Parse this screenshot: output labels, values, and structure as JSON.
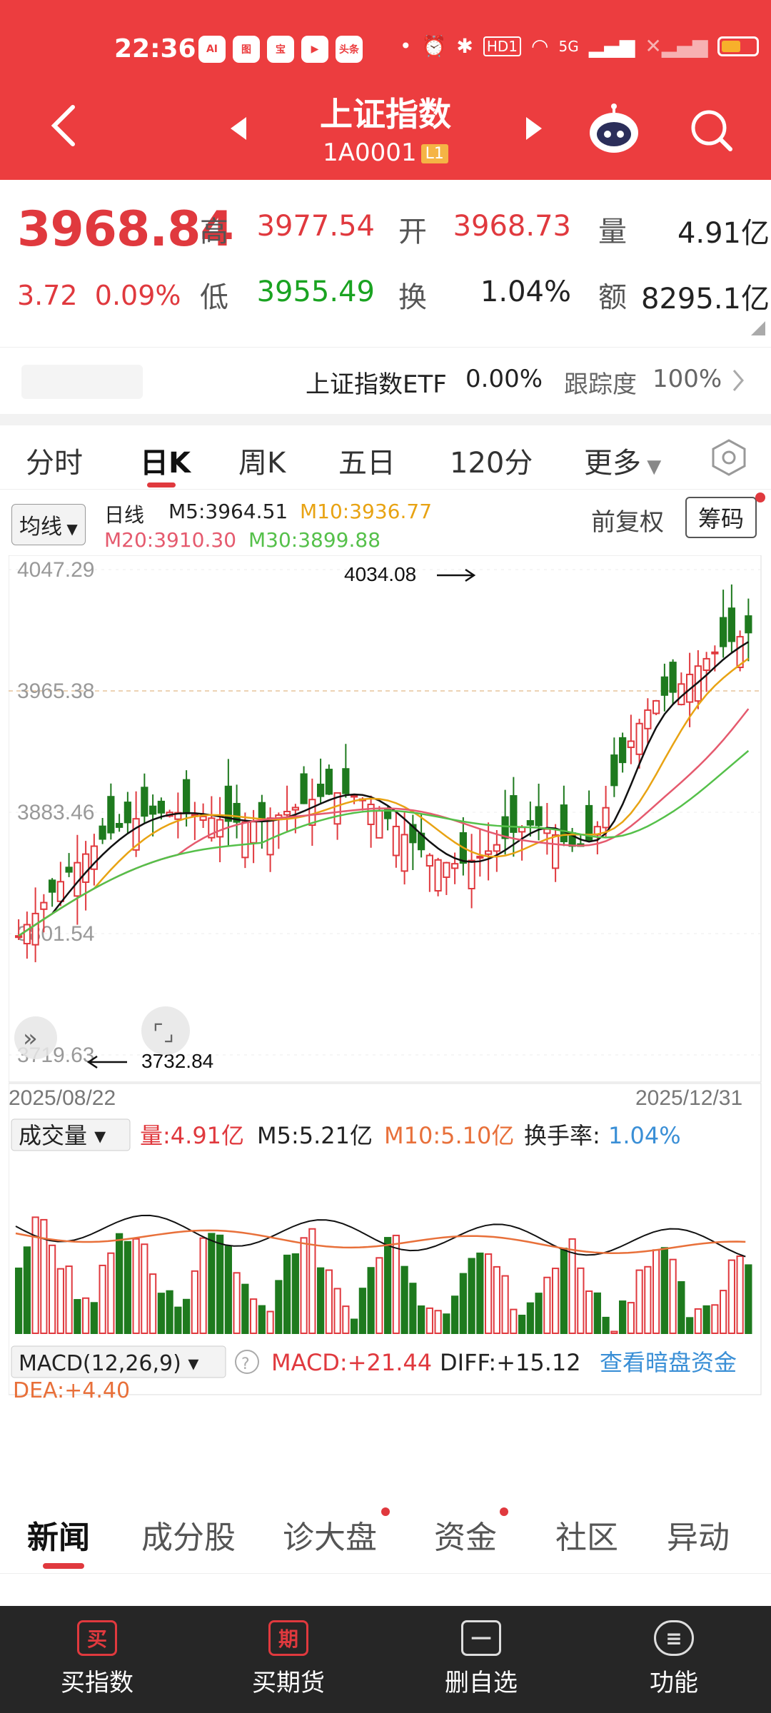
{
  "status_bar": {
    "time": "22:36",
    "apps": [
      "AI",
      "图",
      "宝",
      "▶",
      "头条"
    ],
    "network": "5G",
    "hd": "HD1"
  },
  "header": {
    "title": "上证指数",
    "code": "1A0001",
    "level_badge": "L1",
    "accent": "#ec3d3f"
  },
  "quote": {
    "price": "3968.84",
    "change": "3.72",
    "change_pct": "0.09%",
    "high_label": "高",
    "high": "3977.54",
    "low_label": "低",
    "low": "3955.49",
    "open_label": "开",
    "open": "3968.73",
    "turnover_label": "换",
    "turnover": "1.04%",
    "volume_label": "量",
    "volume": "4.91亿",
    "amount_label": "额",
    "amount": "8295.1亿"
  },
  "etf": {
    "name": "上证指数ETF",
    "pct": "0.00%",
    "tracking_label": "跟踪度",
    "tracking": "100%"
  },
  "tabs": [
    "分时",
    "日K",
    "周K",
    "五日",
    "120分",
    "更多"
  ],
  "active_tab": 1,
  "kline": {
    "ma_button": "均线",
    "period_label": "日线",
    "ma5": "M5:3964.51",
    "ma10": "M10:3936.77",
    "ma20": "M20:3910.30",
    "ma30": "M30:3899.88",
    "adjust": "前复权",
    "chips": "筹码",
    "y_labels": [
      "4047.29",
      "3965.38",
      "3883.46",
      "3801.54",
      "3719.63"
    ],
    "max_marker": "4034.08",
    "min_marker": "3732.84",
    "date_start": "2025/08/22",
    "date_end": "2025/12/31"
  },
  "volume": {
    "button": "成交量",
    "vol": "量:4.91亿",
    "m5": "M5:5.21亿",
    "m10": "M10:5.10亿",
    "turnover_label": "换手率:",
    "turnover": "1.04%"
  },
  "macd": {
    "button": "MACD(12,26,9)",
    "macd": "MACD:+21.44",
    "diff": "DIFF:+15.12",
    "dea": "DEA:+4.40",
    "link": "查看暗盘资金"
  },
  "bottom_tabs": [
    "新闻",
    "成分股",
    "诊大盘",
    "资金",
    "社区",
    "异动"
  ],
  "nav": [
    {
      "icon": "买",
      "label": "买指数"
    },
    {
      "icon": "期",
      "label": "买期货"
    },
    {
      "icon": "一",
      "label": "删自选"
    },
    {
      "icon": "≡",
      "label": "功能"
    }
  ],
  "colors": {
    "up": "#e0393e",
    "down": "#1e7a1e",
    "ma5": "#111111",
    "ma10": "#e8a313",
    "ma20": "#e55a6e",
    "ma30": "#55c04a"
  }
}
